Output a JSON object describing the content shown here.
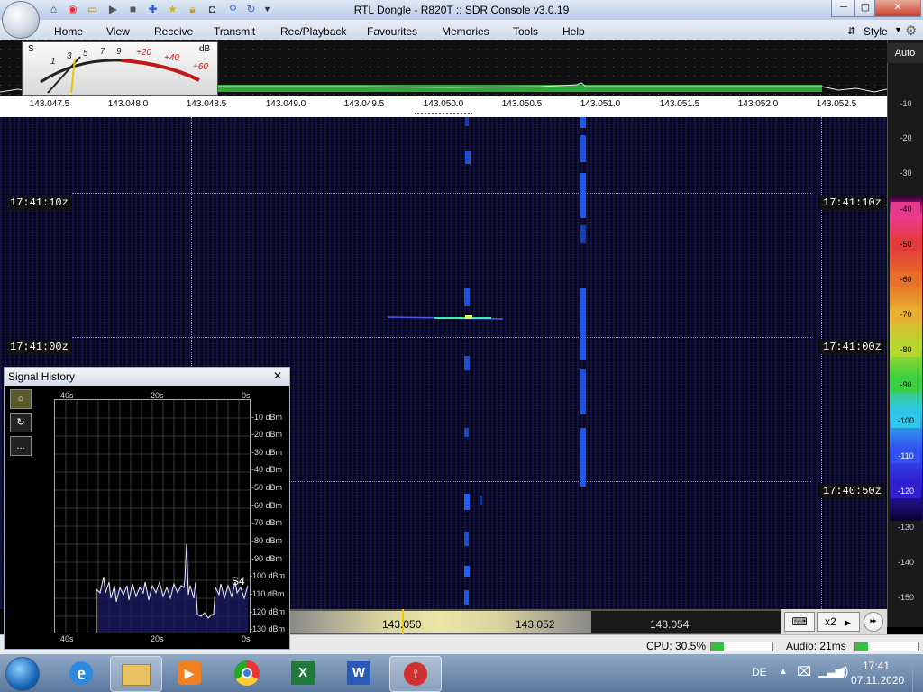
{
  "window": {
    "title": "RTL Dongle - R820T :: SDR Console v3.0.19",
    "min_label": "─",
    "max_label": "▢",
    "close_label": "✕"
  },
  "quick_access": [
    "home-icon",
    "lifebuoy-icon",
    "folder-icon",
    "play-icon",
    "stop-icon",
    "plus-icon",
    "star-icon",
    "lock-icon",
    "camera-icon",
    "bottle-icon",
    "loop-icon",
    "dropdown-icon"
  ],
  "menu": {
    "items": [
      "Home",
      "View",
      "Receive",
      "Transmit",
      "Rec/Playback",
      "Favourites",
      "Memories",
      "Tools",
      "Help"
    ],
    "style_label": "Style"
  },
  "smeter": {
    "s_label": "S",
    "db_label": "dB",
    "s_scale": [
      "1",
      "3",
      "5",
      "7",
      "9"
    ],
    "db_scale": [
      "+20",
      "+40",
      "+60"
    ]
  },
  "freq_scale": [
    "143.047.5",
    "143.048.0",
    "143.048.5",
    "143.049.0",
    "143.049.5",
    "143.050.0",
    "143.050.5",
    "143.051.0",
    "143.051.5",
    "143.052.0",
    "143.052.5"
  ],
  "waterfall": {
    "time_labels": [
      "17:41:10z",
      "17:41:00z",
      "17:40:50z"
    ]
  },
  "right_scale": {
    "auto_label": "Auto",
    "ticks": [
      "-10",
      "-20",
      "-30",
      "-40",
      "-50",
      "-60",
      "-70",
      "-80",
      "-90",
      "-100",
      "-110",
      "-120",
      "-130",
      "-140",
      "-150"
    ],
    "chip_colors": {
      "-40": "#e83a8c",
      "-50": "#e33a3a",
      "-60": "#e8702a",
      "-70": "#e8b030",
      "-80": "#b8d830",
      "-90": "#3ad040",
      "-100": "#30c8e8",
      "-110": "#3050f0",
      "-120": "#3020d0"
    }
  },
  "bottom_bar": {
    "freqs": [
      "143.050",
      "143.052",
      "143.054"
    ],
    "zoom_label": "x2"
  },
  "status": {
    "cpu_label": "CPU: 30.5%",
    "cpu_level": 0.2,
    "audio_label": "Audio: 21ms",
    "audio_level": 0.2
  },
  "signal_history": {
    "title": "Signal History",
    "close_label": "✕",
    "time_top": [
      "40s",
      "20s",
      "0s"
    ],
    "time_bottom": [
      "40s",
      "20s",
      "0s"
    ],
    "y_labels": [
      "-10 dBm",
      "-20 dBm",
      "-30 dBm",
      "-40 dBm",
      "-50 dBm",
      "-60 dBm",
      "-70 dBm",
      "-80 dBm",
      "-90 dBm",
      "-100 dBm",
      "-110 dBm",
      "-120 dBm",
      "-130 dBm"
    ],
    "s_reading": "S4",
    "side_buttons": [
      "○",
      "↻",
      "..."
    ]
  },
  "taskbar": {
    "language": "DE",
    "time": "17:41",
    "date": "07.11.2020",
    "apps": [
      "internet-explorer-icon",
      "file-explorer-icon",
      "media-player-icon",
      "chrome-icon",
      "excel-icon",
      "word-icon",
      "sdr-console-icon"
    ]
  }
}
